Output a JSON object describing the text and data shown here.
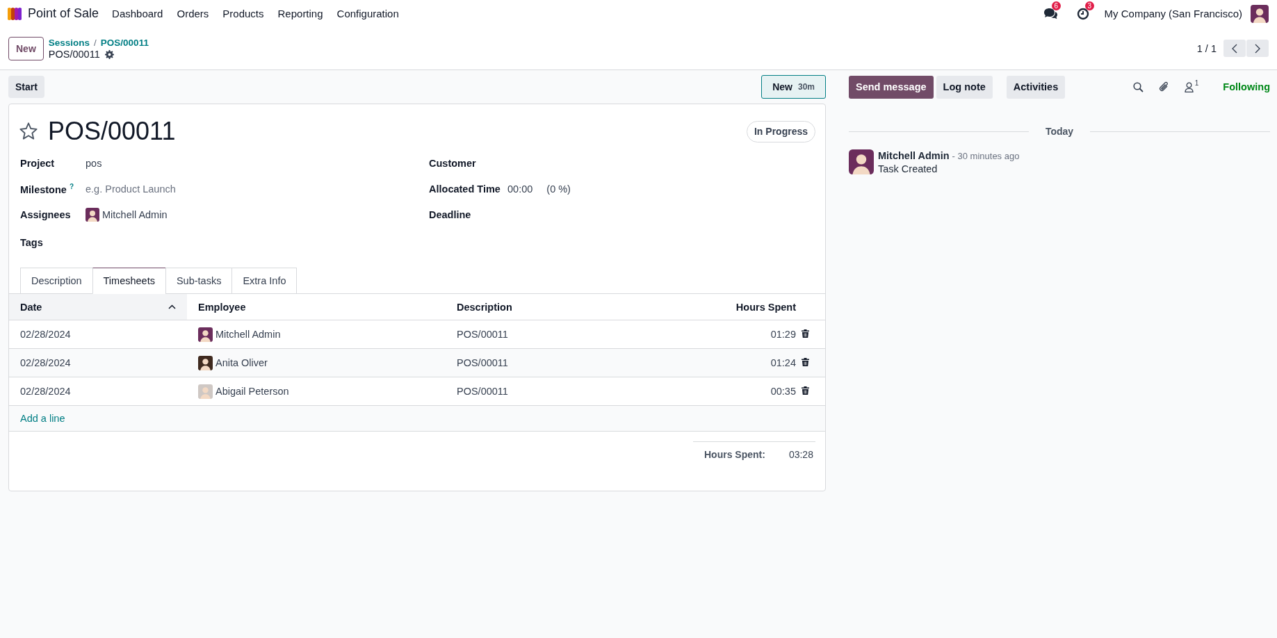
{
  "navbar": {
    "app_name": "Point of Sale",
    "menu": [
      "Dashboard",
      "Orders",
      "Products",
      "Reporting",
      "Configuration"
    ],
    "messages_badge": "6",
    "activities_badge": "3",
    "company": "My Company (San Francisco)"
  },
  "control_panel": {
    "new_button": "New",
    "breadcrumbs": [
      "Sessions",
      "POS/00011"
    ],
    "breadcrumb_separator": "/",
    "record_name": "POS/00011",
    "pager": "1 / 1"
  },
  "statusbar": {
    "buttons": [
      "Start"
    ],
    "stage": {
      "label": "New",
      "duration": "30m"
    }
  },
  "form": {
    "starred": false,
    "title": "POS/00011",
    "state": "In Progress",
    "fields_left": [
      {
        "kind": "text",
        "label": "Project",
        "value": "pos"
      },
      {
        "kind": "placeholder",
        "label": "Milestone",
        "help": "?",
        "placeholder": "e.g. Product Launch"
      },
      {
        "kind": "user",
        "label": "Assignees",
        "value": "Mitchell Admin"
      },
      {
        "kind": "empty",
        "label": "Tags"
      }
    ],
    "fields_right": [
      {
        "kind": "empty",
        "label": "Customer"
      },
      {
        "kind": "duration",
        "label": "Allocated Time",
        "value": "00:00",
        "extra": "(0 %)"
      },
      {
        "kind": "empty",
        "label": "Deadline"
      }
    ],
    "tabs": [
      {
        "label": "Description",
        "selected": false
      },
      {
        "label": "Timesheets",
        "selected": true
      },
      {
        "label": "Sub-tasks",
        "selected": false
      },
      {
        "label": "Extra Info",
        "selected": false
      }
    ],
    "timesheets": {
      "columns": [
        {
          "label": "Date",
          "sorted": true
        },
        {
          "label": "Employee",
          "sorted": false
        },
        {
          "label": "Description",
          "sorted": false
        },
        {
          "label": "Hours Spent",
          "sorted": false
        }
      ],
      "rows": [
        {
          "date": "02/28/2024",
          "employee": "Mitchell Admin",
          "description": "POS/00011",
          "hours": "01:29"
        },
        {
          "date": "02/28/2024",
          "employee": "Anita Oliver",
          "description": "POS/00011",
          "hours": "01:24"
        },
        {
          "date": "02/28/2024",
          "employee": "Abigail Peterson",
          "description": "POS/00011",
          "hours": "00:35"
        }
      ],
      "add_line": "Add a line",
      "total_label": "Hours Spent:",
      "total_value": "03:28"
    }
  },
  "chatter": {
    "buttons": [
      {
        "label": "Send message",
        "kind": "primary"
      },
      {
        "label": "Log note",
        "kind": "secondary"
      },
      {
        "label": "Activities",
        "kind": "activity"
      }
    ],
    "followers_count": "1",
    "follow_status": "Following",
    "date_separator": "Today",
    "messages": [
      {
        "author": "Mitchell Admin",
        "time": "- 30 minutes ago",
        "body": "Task Created"
      }
    ]
  }
}
